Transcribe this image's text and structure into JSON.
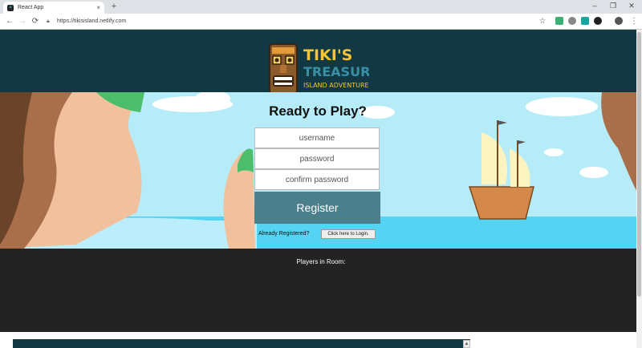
{
  "browser": {
    "tab_title": "React App",
    "tab_close": "×",
    "new_tab": "+",
    "url": "https://tikisisland.netlify.com",
    "nav": {
      "back": "←",
      "forward": "→",
      "reload": "⟳"
    },
    "window": {
      "minimize": "–",
      "restore": "❐",
      "close": "✕"
    },
    "menu": "⋮",
    "star": "☆"
  },
  "logo": {
    "line1": "TIKI'S",
    "line2": "TREASURE",
    "line3": "ISLAND ADVENTURE"
  },
  "register_form": {
    "heading": "Ready to Play?",
    "username_placeholder": "username",
    "password_placeholder": "password",
    "confirm_placeholder": "confirm password",
    "submit_label": "Register",
    "already_text": "Already Registered?",
    "login_label": "Click here to Login."
  },
  "players": {
    "title": "Players in Room:"
  },
  "colors": {
    "header_bg": "#123943",
    "sky": "#b6ecf7",
    "sea": "#55d3f2",
    "register_bg": "#4a7f8b",
    "players_bg": "#232323",
    "logo_yellow": "#f7c531",
    "logo_teal": "#3b8fa5"
  }
}
